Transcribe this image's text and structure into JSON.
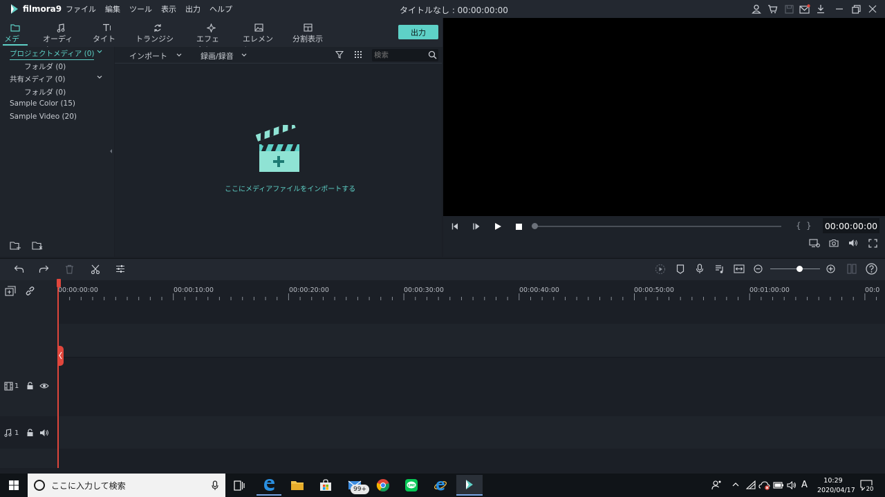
{
  "app": {
    "logo_text": "filmora9",
    "window_title": "タイトルなし : 00:00:00:00"
  },
  "menu": [
    "ファイル",
    "編集",
    "ツール",
    "表示",
    "出力",
    "ヘルプ"
  ],
  "tabs": [
    "メディア",
    "オーディオ",
    "タイトル",
    "トランジション",
    "エフェクト",
    "エレメント",
    "分割表示"
  ],
  "export_label": "出力",
  "sidebar": {
    "items": [
      {
        "label": "プロジェクトメディア (0)"
      },
      {
        "label": "フォルダ (0)"
      },
      {
        "label": "共有メディア (0)"
      },
      {
        "label": "フォルダ (0)"
      },
      {
        "label": "Sample Color (15)"
      },
      {
        "label": "Sample Video (20)"
      }
    ]
  },
  "media": {
    "import_label": "インポート",
    "record_label": "録画/録音",
    "search_placeholder": "検索",
    "empty_hint": "ここにメディアファイルをインポートする"
  },
  "preview": {
    "timecode": "00:00:00:00"
  },
  "ruler": [
    "00:00:00:00",
    "00:00:10:00",
    "00:00:20:00",
    "00:00:30:00",
    "00:00:40:00",
    "00:00:50:00",
    "00:01:00:00",
    "00:0"
  ],
  "tracks": {
    "video_label": "1",
    "audio_label": "1"
  },
  "taskbar": {
    "search_placeholder": "ここに入力して検索",
    "mail_badge": "99+",
    "ime": "A",
    "time": "10:29",
    "date": "2020/04/17",
    "notifications": "20"
  },
  "colors": {
    "accent": "#5ed1c7",
    "playhead": "#e0463c"
  }
}
